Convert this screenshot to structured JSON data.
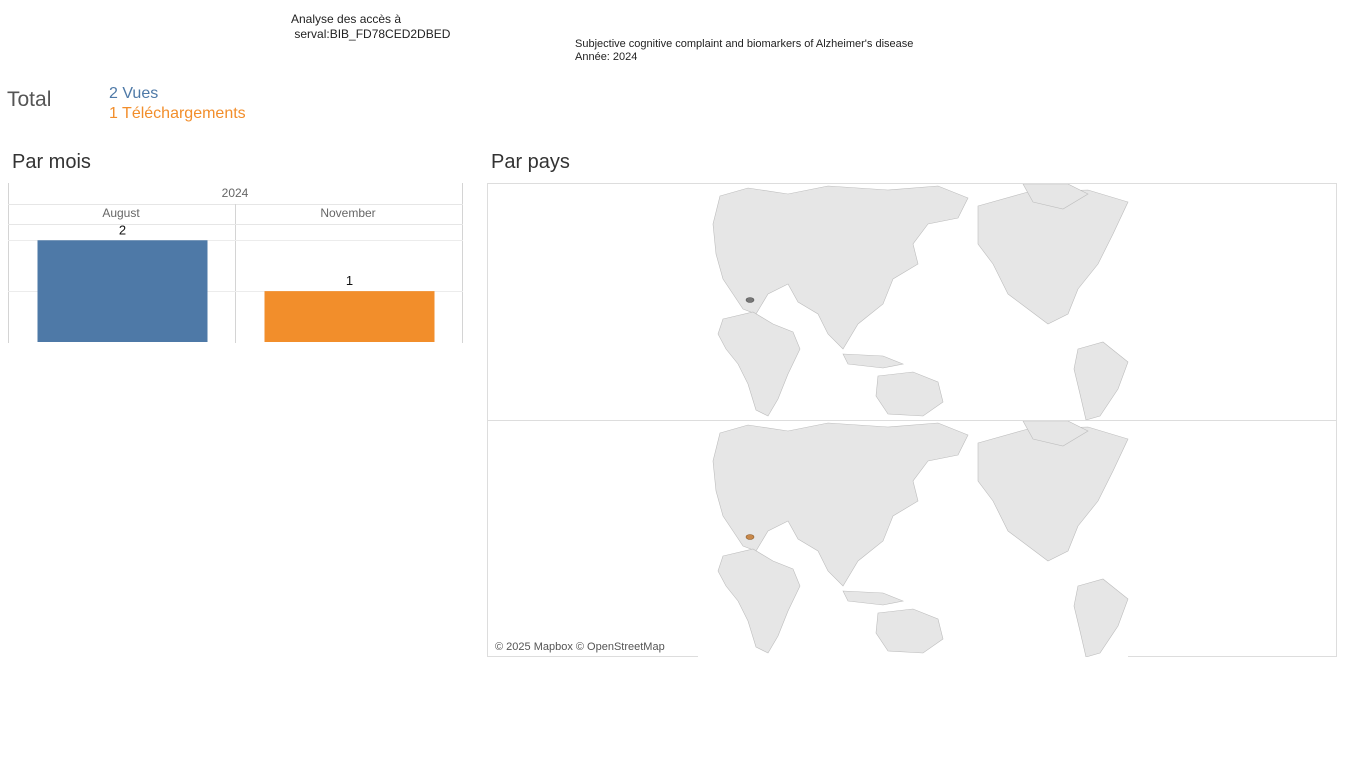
{
  "header": {
    "analyse_line1": "Analyse des accès à",
    "analyse_line2": "serval:BIB_FD78CED2DBED",
    "document_title": "Subjective cognitive complaint and biomarkers of Alzheimer's disease",
    "year_line": "Année: 2024"
  },
  "totals": {
    "label": "Total",
    "views": "2 Vues",
    "downloads": "1 Téléchargements"
  },
  "sections": {
    "by_month": "Par mois",
    "by_country": "Par pays"
  },
  "chart_data": {
    "type": "bar",
    "year_header": "2024",
    "categories": [
      "August",
      "November"
    ],
    "series": [
      {
        "values": [
          2,
          null
        ],
        "color": "#4e79a7"
      },
      {
        "values": [
          null,
          1
        ],
        "color": "#f28e2b"
      }
    ],
    "data_labels": [
      "2",
      "1"
    ],
    "ylim": [
      0,
      2.3
    ],
    "grid": true
  },
  "map": {
    "attribution": "© 2025 Mapbox © OpenStreetMap",
    "highlight_views_color": "#767676",
    "highlight_downloads_color": "#c8884a"
  }
}
